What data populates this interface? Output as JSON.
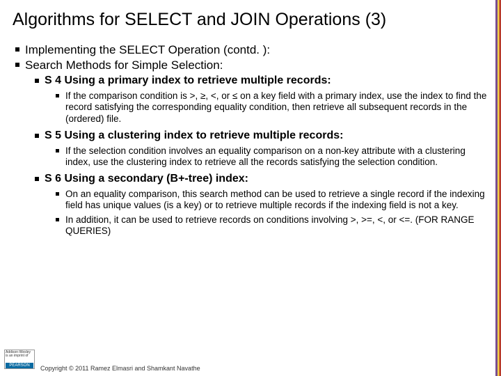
{
  "title": "Algorithms for SELECT and JOIN Operations (3)",
  "bullets": {
    "b1": "Implementing the SELECT Operation (contd. ):",
    "b2": "Search Methods for Simple Selection:",
    "s4": "S 4 Using a primary index to retrieve multiple records:",
    "s4_1": "If the comparison condition is >, ≥, <, or ≤ on a key field with a primary index, use the index to find the record satisfying the corresponding equality condition, then retrieve all subsequent records in the (ordered) file.",
    "s5": "S 5 Using a clustering index to retrieve multiple records:",
    "s5_1": "If the selection condition involves an equality comparison on a non-key attribute with a clustering index, use the clustering index to retrieve all the records satisfying the selection condition.",
    "s6": "S 6 Using a secondary (B+-tree) index:",
    "s6_1": "On an equality comparison, this search method can be used to retrieve a single record if the indexing field has unique values (is a key) or to retrieve multiple records if the indexing field is not a key.",
    "s6_2": "In addition, it can be used to retrieve records on conditions involving >, >=, <, or <=. (FOR RANGE QUERIES)"
  },
  "footer": {
    "copyright": "Copyright © 2011 Ramez Elmasri and Shamkant Navathe",
    "publisher_top": "Addison-Wesley",
    "publisher_sub": "is an imprint of",
    "publisher_brand": "PEARSON"
  }
}
